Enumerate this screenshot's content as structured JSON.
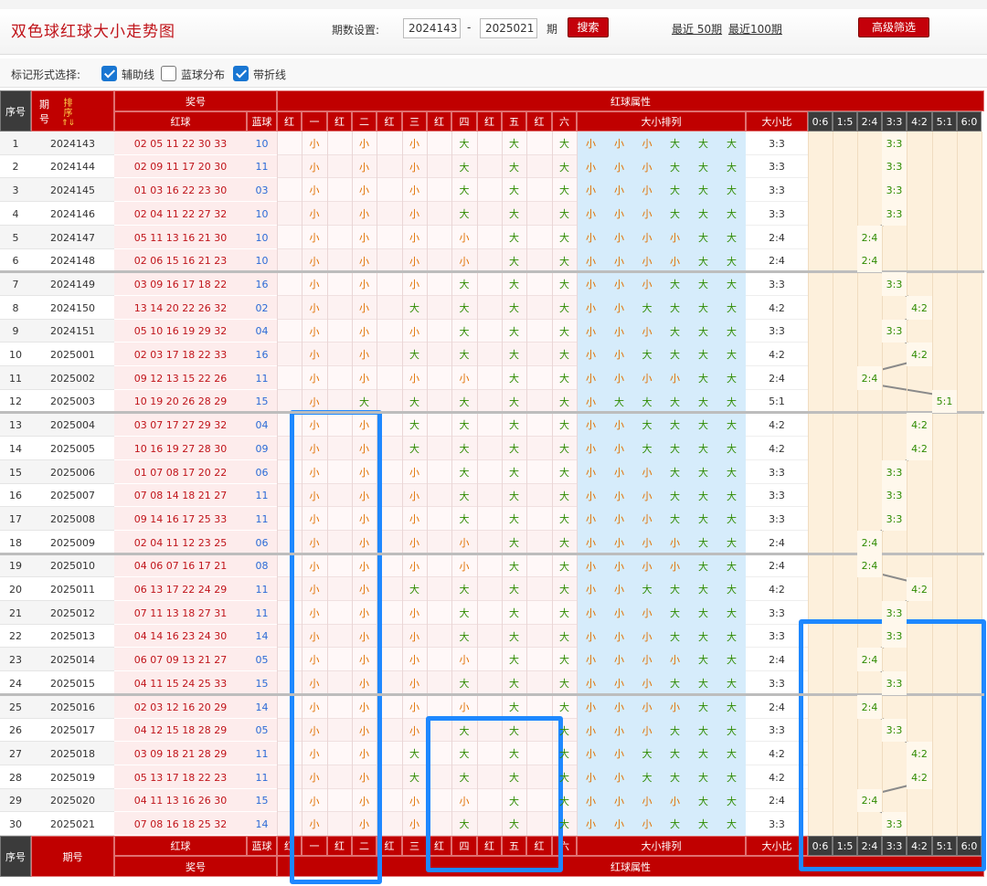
{
  "header": {
    "title": "双色球红球大小走势图",
    "period_label": "期数设置:",
    "start_period": "2024143",
    "dash": "-",
    "end_period": "2025021",
    "period_unit": "期",
    "search_label": "搜索",
    "recent50_label": "最近 50期",
    "recent100_label": "最近100期",
    "advanced_label": "高级筛选"
  },
  "options": {
    "label": "标记形式选择:",
    "items": [
      {
        "label": "辅助线",
        "checked": true
      },
      {
        "label": "蓝球分布",
        "checked": false
      },
      {
        "label": "带折线",
        "checked": true
      }
    ]
  },
  "table": {
    "h_seq": "序号",
    "h_period_1": "期",
    "h_period_2": "号",
    "h_sort": "排序",
    "h_jianghao": "奖号",
    "h_red": "红球",
    "h_blue": "蓝球",
    "h_attr": "红球属性",
    "h_pos": [
      "红",
      "一",
      "红",
      "二",
      "红",
      "三",
      "红",
      "四",
      "红",
      "五",
      "红",
      "六"
    ],
    "h_order": "大小排列",
    "h_ratio": "大小比",
    "h_dist": [
      "0:6",
      "1:5",
      "2:4",
      "3:3",
      "4:2",
      "5:1",
      "6:0"
    ],
    "f_period": "期号",
    "rows": [
      {
        "seq": "1",
        "period": "2024143",
        "red": "02 05 11 22 30 33",
        "blue": "10",
        "attr": [
          "小",
          "小",
          "小",
          "大",
          "大",
          "大"
        ],
        "ratio": "3:3"
      },
      {
        "seq": "2",
        "period": "2024144",
        "red": "02 09 11 17 20 30",
        "blue": "11",
        "attr": [
          "小",
          "小",
          "小",
          "大",
          "大",
          "大"
        ],
        "ratio": "3:3"
      },
      {
        "seq": "3",
        "period": "2024145",
        "red": "01 03 16 22 23 30",
        "blue": "03",
        "attr": [
          "小",
          "小",
          "小",
          "大",
          "大",
          "大"
        ],
        "ratio": "3:3"
      },
      {
        "seq": "4",
        "period": "2024146",
        "red": "02 04 11 22 27 32",
        "blue": "10",
        "attr": [
          "小",
          "小",
          "小",
          "大",
          "大",
          "大"
        ],
        "ratio": "3:3"
      },
      {
        "seq": "5",
        "period": "2024147",
        "red": "05 11 13 16 21 30",
        "blue": "10",
        "attr": [
          "小",
          "小",
          "小",
          "小",
          "大",
          "大"
        ],
        "ratio": "2:4"
      },
      {
        "seq": "6",
        "period": "2024148",
        "red": "02 06 15 16 21 23",
        "blue": "10",
        "attr": [
          "小",
          "小",
          "小",
          "小",
          "大",
          "大"
        ],
        "ratio": "2:4"
      },
      {
        "seq": "7",
        "period": "2024149",
        "red": "03 09 16 17 18 22",
        "blue": "16",
        "attr": [
          "小",
          "小",
          "小",
          "大",
          "大",
          "大"
        ],
        "ratio": "3:3"
      },
      {
        "seq": "8",
        "period": "2024150",
        "red": "13 14 20 22 26 32",
        "blue": "02",
        "attr": [
          "小",
          "小",
          "大",
          "大",
          "大",
          "大"
        ],
        "ratio": "4:2"
      },
      {
        "seq": "9",
        "period": "2024151",
        "red": "05 10 16 19 29 32",
        "blue": "04",
        "attr": [
          "小",
          "小",
          "小",
          "大",
          "大",
          "大"
        ],
        "ratio": "3:3"
      },
      {
        "seq": "10",
        "period": "2025001",
        "red": "02 03 17 18 22 33",
        "blue": "16",
        "attr": [
          "小",
          "小",
          "大",
          "大",
          "大",
          "大"
        ],
        "ratio": "4:2"
      },
      {
        "seq": "11",
        "period": "2025002",
        "red": "09 12 13 15 22 26",
        "blue": "11",
        "attr": [
          "小",
          "小",
          "小",
          "小",
          "大",
          "大"
        ],
        "ratio": "2:4"
      },
      {
        "seq": "12",
        "period": "2025003",
        "red": "10 19 20 26 28 29",
        "blue": "15",
        "attr": [
          "小",
          "大",
          "大",
          "大",
          "大",
          "大"
        ],
        "ratio": "5:1"
      },
      {
        "seq": "13",
        "period": "2025004",
        "red": "03 07 17 27 29 32",
        "blue": "04",
        "attr": [
          "小",
          "小",
          "大",
          "大",
          "大",
          "大"
        ],
        "ratio": "4:2"
      },
      {
        "seq": "14",
        "period": "2025005",
        "red": "10 16 19 27 28 30",
        "blue": "09",
        "attr": [
          "小",
          "小",
          "大",
          "大",
          "大",
          "大"
        ],
        "ratio": "4:2"
      },
      {
        "seq": "15",
        "period": "2025006",
        "red": "01 07 08 17 20 22",
        "blue": "06",
        "attr": [
          "小",
          "小",
          "小",
          "大",
          "大",
          "大"
        ],
        "ratio": "3:3"
      },
      {
        "seq": "16",
        "period": "2025007",
        "red": "07 08 14 18 21 27",
        "blue": "11",
        "attr": [
          "小",
          "小",
          "小",
          "大",
          "大",
          "大"
        ],
        "ratio": "3:3"
      },
      {
        "seq": "17",
        "period": "2025008",
        "red": "09 14 16 17 25 33",
        "blue": "11",
        "attr": [
          "小",
          "小",
          "小",
          "大",
          "大",
          "大"
        ],
        "ratio": "3:3"
      },
      {
        "seq": "18",
        "period": "2025009",
        "red": "02 04 11 12 23 25",
        "blue": "06",
        "attr": [
          "小",
          "小",
          "小",
          "小",
          "大",
          "大"
        ],
        "ratio": "2:4"
      },
      {
        "seq": "19",
        "period": "2025010",
        "red": "04 06 07 16 17 21",
        "blue": "08",
        "attr": [
          "小",
          "小",
          "小",
          "小",
          "大",
          "大"
        ],
        "ratio": "2:4"
      },
      {
        "seq": "20",
        "period": "2025011",
        "red": "06 13 17 22 24 29",
        "blue": "11",
        "attr": [
          "小",
          "小",
          "大",
          "大",
          "大",
          "大"
        ],
        "ratio": "4:2"
      },
      {
        "seq": "21",
        "period": "2025012",
        "red": "07 11 13 18 27 31",
        "blue": "11",
        "attr": [
          "小",
          "小",
          "小",
          "大",
          "大",
          "大"
        ],
        "ratio": "3:3"
      },
      {
        "seq": "22",
        "period": "2025013",
        "red": "04 14 16 23 24 30",
        "blue": "14",
        "attr": [
          "小",
          "小",
          "小",
          "大",
          "大",
          "大"
        ],
        "ratio": "3:3"
      },
      {
        "seq": "23",
        "period": "2025014",
        "red": "06 07 09 13 21 27",
        "blue": "05",
        "attr": [
          "小",
          "小",
          "小",
          "小",
          "大",
          "大"
        ],
        "ratio": "2:4"
      },
      {
        "seq": "24",
        "period": "2025015",
        "red": "04 11 15 24 25 33",
        "blue": "15",
        "attr": [
          "小",
          "小",
          "小",
          "大",
          "大",
          "大"
        ],
        "ratio": "3:3"
      },
      {
        "seq": "25",
        "period": "2025016",
        "red": "02 03 12 16 20 29",
        "blue": "14",
        "attr": [
          "小",
          "小",
          "小",
          "小",
          "大",
          "大"
        ],
        "ratio": "2:4"
      },
      {
        "seq": "26",
        "period": "2025017",
        "red": "04 12 15 18 28 29",
        "blue": "05",
        "attr": [
          "小",
          "小",
          "小",
          "大",
          "大",
          "大"
        ],
        "ratio": "3:3"
      },
      {
        "seq": "27",
        "period": "2025018",
        "red": "03 09 18 21 28 29",
        "blue": "11",
        "attr": [
          "小",
          "小",
          "大",
          "大",
          "大",
          "大"
        ],
        "ratio": "4:2"
      },
      {
        "seq": "28",
        "period": "2025019",
        "red": "05 13 17 18 22 23",
        "blue": "11",
        "attr": [
          "小",
          "小",
          "大",
          "大",
          "大",
          "大"
        ],
        "ratio": "4:2"
      },
      {
        "seq": "29",
        "period": "2025020",
        "red": "04 11 13 16 26 30",
        "blue": "15",
        "attr": [
          "小",
          "小",
          "小",
          "小",
          "大",
          "大"
        ],
        "ratio": "2:4"
      },
      {
        "seq": "30",
        "period": "2025021",
        "red": "07 08 16 18 25 32",
        "blue": "14",
        "attr": [
          "小",
          "小",
          "小",
          "大",
          "大",
          "大"
        ],
        "ratio": "3:3"
      }
    ]
  },
  "colors": {
    "header_red": "#c00000",
    "red_text": "#c0141a",
    "blue_text": "#2b6bd6",
    "small_text": "#e07000",
    "big_text": "#2e8b00",
    "pink_row": "#fdecec",
    "light_blue_bg": "#d6ecfb",
    "dist_bg": "#fdf0dc",
    "highlight": "#1e88ff"
  }
}
